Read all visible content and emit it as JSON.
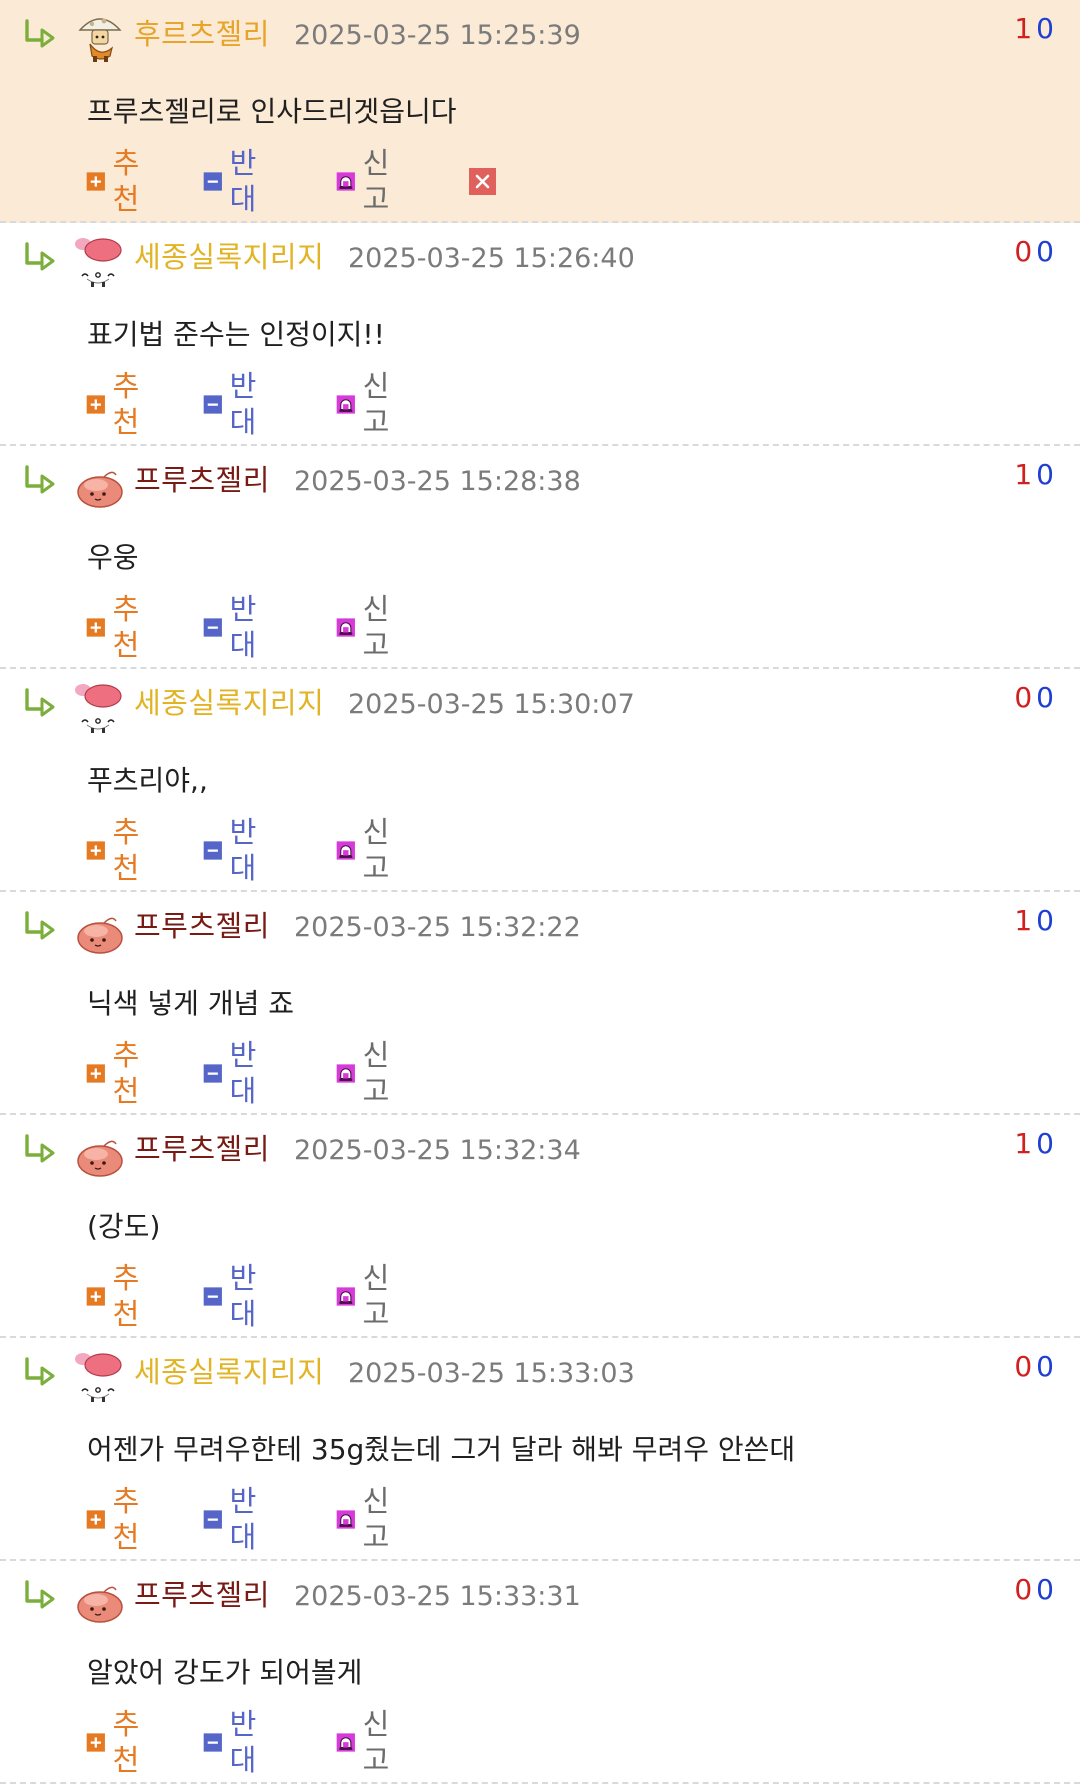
{
  "labels": {
    "recommend": "추천",
    "oppose": "반대",
    "report": "신고"
  },
  "colors": {
    "highlight_bg": "#fbead6",
    "recommend": "#e57a22",
    "oppose": "#5566c8",
    "report_icon": "#d63ad8",
    "vote_up": "#d21f1f",
    "vote_down": "#1f3fd2",
    "reply_arrow": "#7cae3c"
  },
  "comments": [
    {
      "author": "후르츠젤리",
      "author_color": "#e8a42a",
      "avatar": "mushroom-character-icon",
      "timestamp": "2025-03-25 15:25:39",
      "text": "프루츠젤리로 인사드리겟읍니다",
      "up": "1",
      "down": "0",
      "highlight": true,
      "deletable": true
    },
    {
      "author": "세종실록지리지",
      "author_color": "#e2b324",
      "avatar": "mouse-character-icon",
      "timestamp": "2025-03-25 15:26:40",
      "text": "표기법 준수는 인정이지!!",
      "up": "0",
      "down": "0"
    },
    {
      "author": "프루츠젤리",
      "author_color": "#7a1a14",
      "avatar": "pink-slime-icon",
      "timestamp": "2025-03-25 15:28:38",
      "text": "우웅",
      "up": "1",
      "down": "0"
    },
    {
      "author": "세종실록지리지",
      "author_color": "#e2b324",
      "avatar": "mouse-character-icon",
      "timestamp": "2025-03-25 15:30:07",
      "text": "푸츠리야,,",
      "up": "0",
      "down": "0"
    },
    {
      "author": "프루츠젤리",
      "author_color": "#7a1a14",
      "avatar": "pink-slime-icon",
      "timestamp": "2025-03-25 15:32:22",
      "text": "닉색 넣게 개념 죠",
      "up": "1",
      "down": "0"
    },
    {
      "author": "프루츠젤리",
      "author_color": "#7a1a14",
      "avatar": "pink-slime-icon",
      "timestamp": "2025-03-25 15:32:34",
      "text": "(강도)",
      "up": "1",
      "down": "0"
    },
    {
      "author": "세종실록지리지",
      "author_color": "#e2b324",
      "avatar": "mouse-character-icon",
      "timestamp": "2025-03-25 15:33:03",
      "text": "어젠가 무려우한테 35g줬는데 그거 달라 해봐 무려우 안쓴대",
      "up": "0",
      "down": "0"
    },
    {
      "author": "프루츠젤리",
      "author_color": "#7a1a14",
      "avatar": "pink-slime-icon",
      "timestamp": "2025-03-25 15:33:31",
      "text": "알았어 강도가 되어볼게",
      "up": "0",
      "down": "0"
    }
  ]
}
